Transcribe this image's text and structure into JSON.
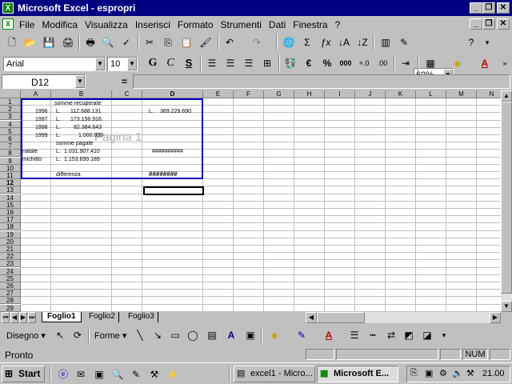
{
  "window": {
    "title": "Microsoft Excel - espropri"
  },
  "menu": [
    "File",
    "Modifica",
    "Visualizza",
    "Inserisci",
    "Formato",
    "Strumenti",
    "Dati",
    "Finestra",
    "?"
  ],
  "toolbar": {
    "zoom": "60%"
  },
  "format_toolbar": {
    "font": "Arial",
    "size": "10"
  },
  "formula_bar": {
    "name_box": "D12",
    "equals": "="
  },
  "columns": [
    "A",
    "B",
    "C",
    "D",
    "E",
    "F",
    "G",
    "H",
    "I",
    "J",
    "K",
    "L",
    "M",
    "N"
  ],
  "rows": [
    "1",
    "2",
    "3",
    "4",
    "5",
    "6",
    "7",
    "8",
    "9",
    "10",
    "11",
    "12",
    "13",
    "14",
    "15",
    "16",
    "17",
    "18",
    "19",
    "20",
    "21",
    "22",
    "23",
    "24",
    "25",
    "26",
    "27",
    "28",
    "29"
  ],
  "cells": {
    "b1": "somme recuperate",
    "a2": "1996",
    "b2_l": "L.",
    "b2": "112.688.131",
    "d2_l": "L.",
    "d2": "369.229.690",
    "a3": "1997",
    "b3_l": "L.",
    "b3": "173.156.916",
    "a4": "1998",
    "b4_l": "L.",
    "b4": "82.384.643",
    "a5": "1999",
    "b5_l": "L.",
    "b5": "1.000.000",
    "b6": "somme pagate",
    "a7": "natale",
    "b7_l": "L.",
    "b7": "1.031.907.410",
    "d7": "##########",
    "a8": "michitto",
    "b8_l": "L.",
    "b8": "1.153.699.189",
    "b10": "differenza",
    "d10": "########"
  },
  "page_watermark": "Pagina 1",
  "sheet_tabs": [
    "Foglio1",
    "Foglio2",
    "Foglio3"
  ],
  "draw_toolbar": {
    "draw_label": "Disegno",
    "shapes_label": "Forme"
  },
  "status": {
    "text": "Pronto",
    "num": "NUM"
  },
  "taskbar": {
    "start": "Start",
    "task1": "excel1 - Micro...",
    "task2": "Microsoft E...",
    "clock": "21.00"
  }
}
